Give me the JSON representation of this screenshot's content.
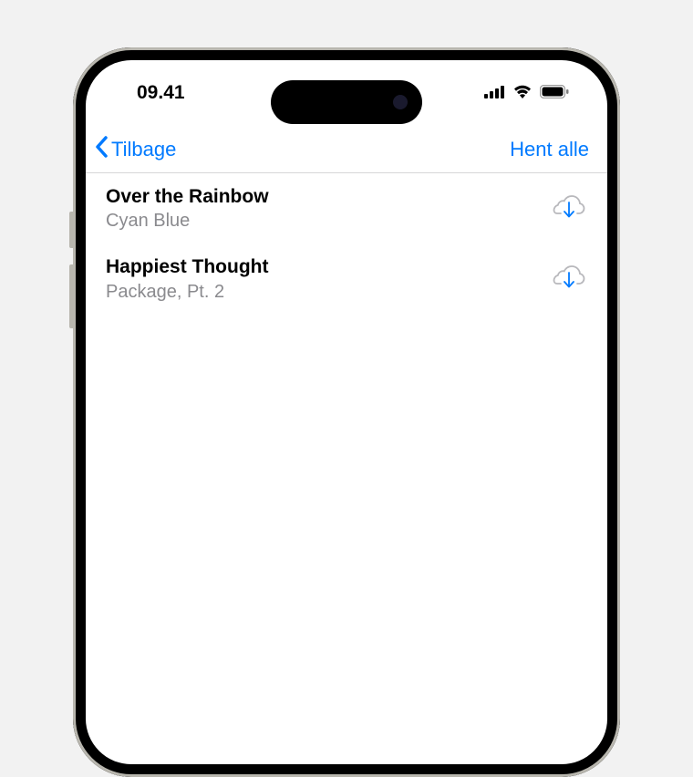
{
  "status": {
    "time": "09.41"
  },
  "nav": {
    "back_label": "Tilbage",
    "download_all_label": "Hent alle"
  },
  "items": [
    {
      "title": "Over the Rainbow",
      "subtitle": "Cyan Blue"
    },
    {
      "title": "Happiest Thought",
      "subtitle": "Package, Pt. 2"
    }
  ]
}
